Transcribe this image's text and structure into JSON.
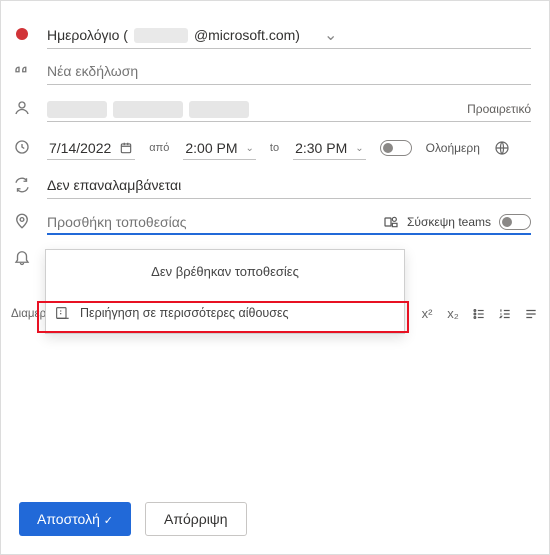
{
  "calendar": {
    "prefix": "Ημερολόγιο (",
    "email_suffix": "@microsoft.com)",
    "chevron": "⌄"
  },
  "title": {
    "placeholder": "Νέα εκδήλωση"
  },
  "people": {
    "optional_label": "Προαιρετικό"
  },
  "datetime": {
    "date": "7/14/2022",
    "from_label": "από",
    "start": "2:00 PM",
    "to_label": "to",
    "end": "2:30 PM",
    "allday_label": "Ολοήμερη"
  },
  "recurrence": {
    "label": "Δεν επαναλαμβάνεται"
  },
  "location": {
    "placeholder": "Προσθήκη τοποθεσίας",
    "teams_label": "Σύσκεψη teams"
  },
  "location_panel": {
    "no_results": "Δεν βρέθηκαν τοποθεσίες",
    "browse_more": "Περιήγηση σε περισσότερες αίθουσες"
  },
  "sidebar_label": "Διαμερίσματα",
  "formatting": {
    "superscript": "x²",
    "subscript": "x₂",
    "more": "ooo"
  },
  "footer": {
    "send": "Αποστολή",
    "discard": "Απόρριψη"
  }
}
